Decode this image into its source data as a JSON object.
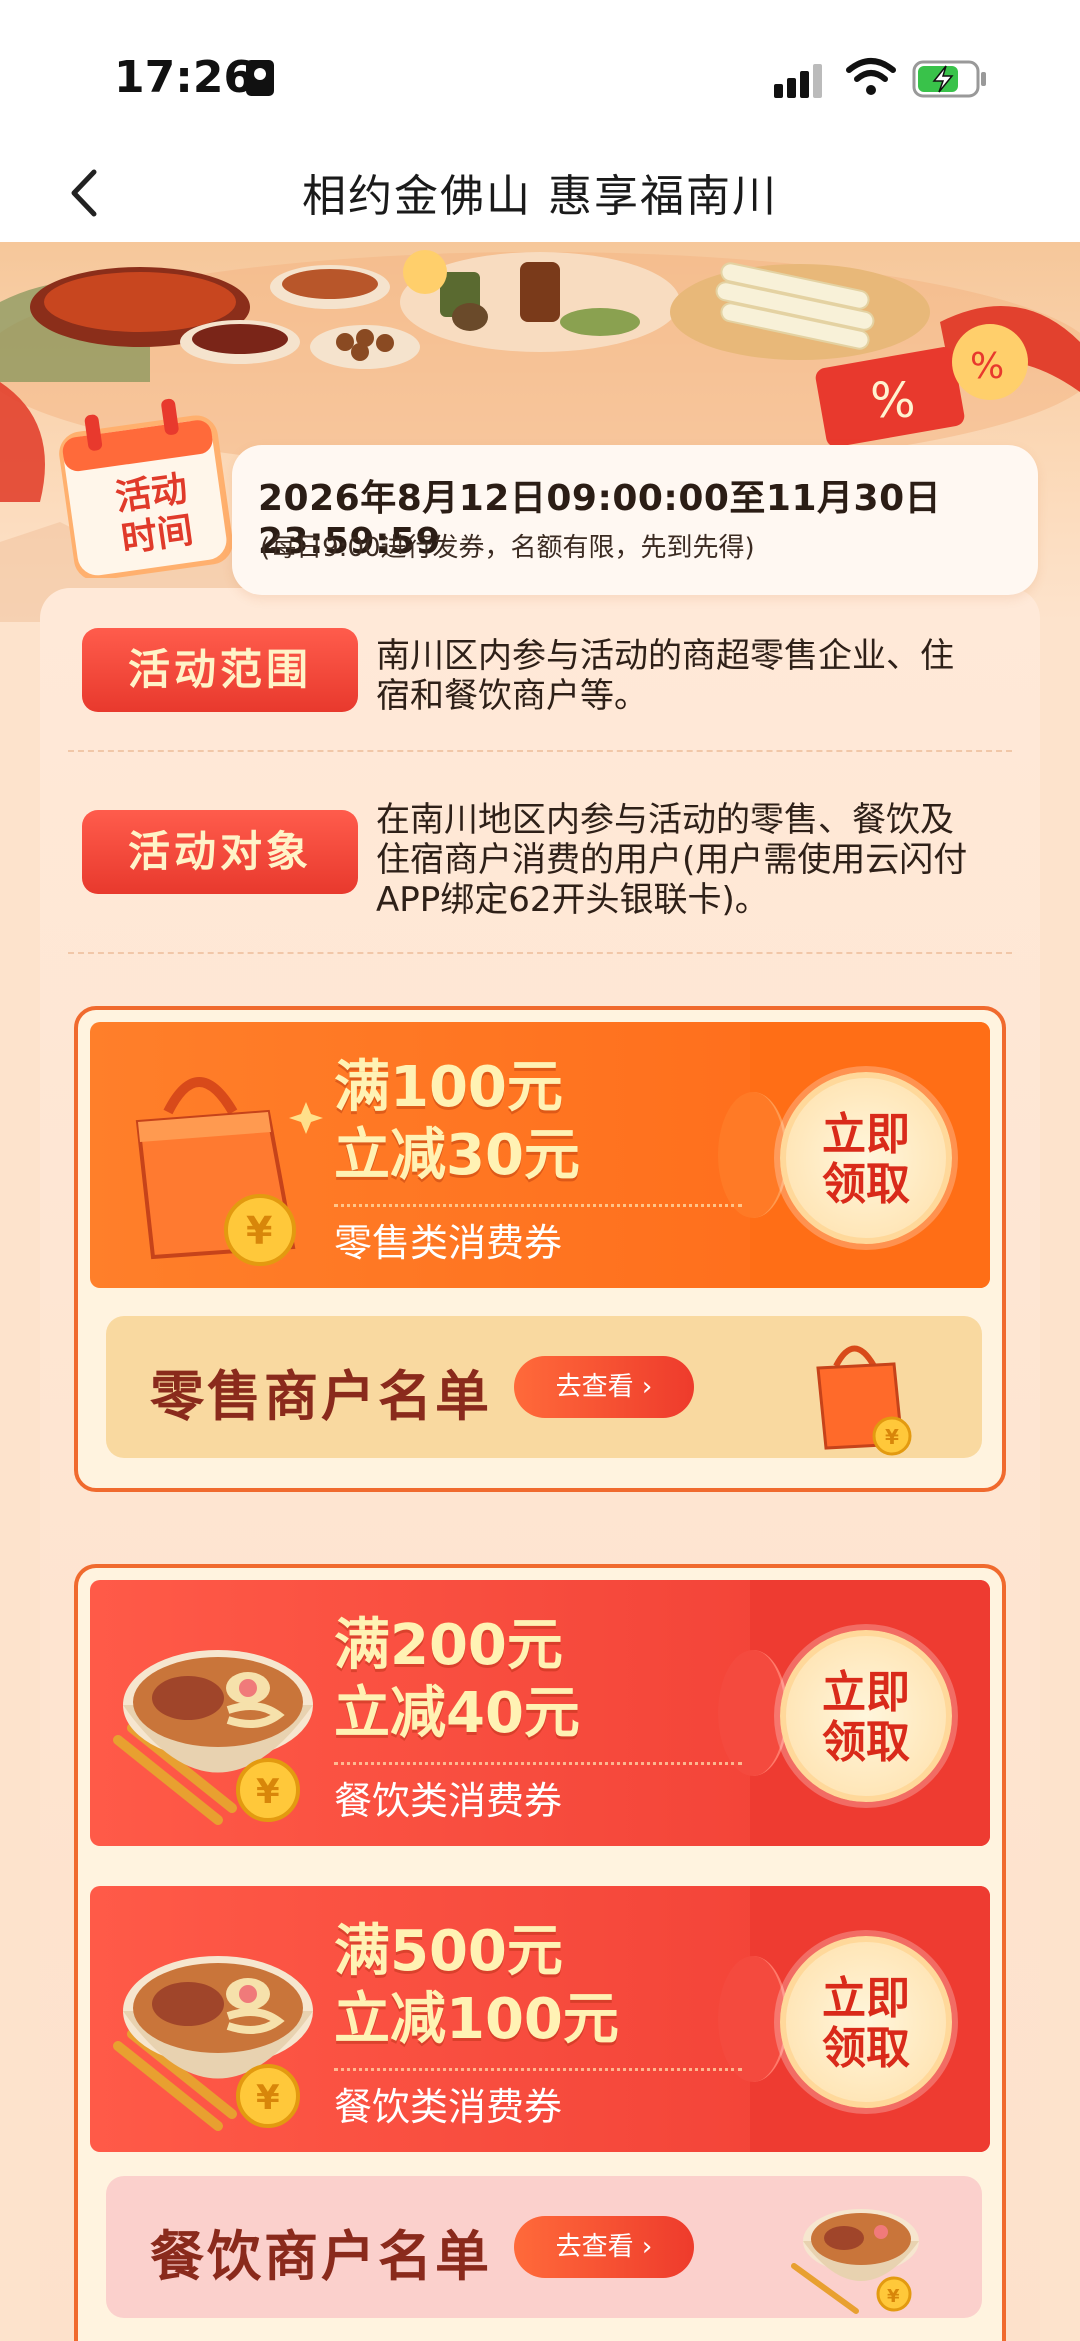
{
  "status_bar": {
    "time": "17:26"
  },
  "nav": {
    "title": "相约金佛山 惠享福南川"
  },
  "calendar_badge": {
    "line1": "活动",
    "line2": "时间"
  },
  "activity_time": {
    "main": "2026年8月12日09:00:00至11月30日23:59:59",
    "note": "(每日9:00进行发券，名额有限，先到先得)"
  },
  "scope": {
    "tag": "活动范围",
    "line1": "南川区内参与活动的商超零售企业、住",
    "line2": "宿和餐饮商户等。"
  },
  "target": {
    "tag": "活动对象",
    "line1": "在南川地区内参与活动的零售、餐饮及",
    "line2": "住宿商户消费的用户(用户需使用云闪付",
    "line3": "APP绑定62开头银联卡)。"
  },
  "retail": {
    "coupons": [
      {
        "line1": "满100元",
        "line2": "立减30元",
        "type": "零售类消费券",
        "button": "立即\n领取"
      }
    ],
    "merchant_list": {
      "title": "零售商户名单",
      "button": "去查看 ›"
    }
  },
  "dining": {
    "coupons": [
      {
        "line1": "满200元",
        "line2": "立减40元",
        "type": "餐饮类消费券",
        "button": "立即\n领取"
      },
      {
        "line1": "满500元",
        "line2": "立减100元",
        "type": "餐饮类消费券",
        "button": "立即\n领取"
      }
    ],
    "merchant_list": {
      "title": "餐饮商户名单",
      "button": "去查看 ›"
    }
  },
  "colors": {
    "tag_red": "#e8392d",
    "coupon_orange": "#ff6a18",
    "coupon_red": "#ef3d33",
    "claim_text": "#d92a1a"
  }
}
